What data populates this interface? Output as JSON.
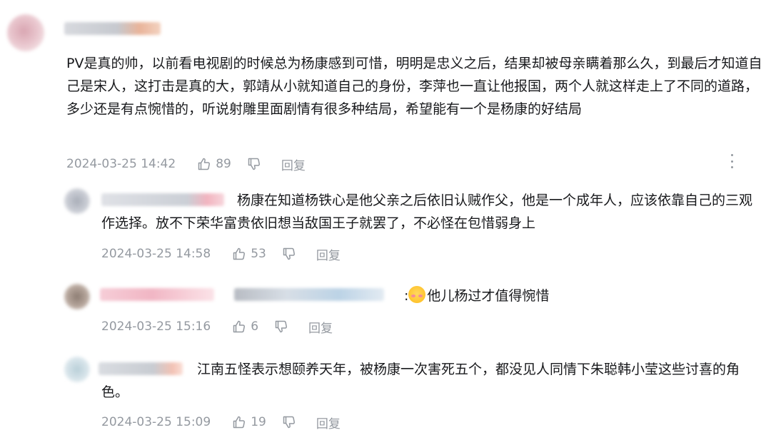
{
  "main_comment": {
    "text": "PV是真的帅，以前看电视剧的时候总为杨康感到可惜，明明是忠义之后，结果却被母亲瞒着那么久，到最后才知道自己是宋人，这打击是真的大，郭靖从小就知道自己的身份，李萍也一直让他报国，两个人就这样走上了不同的道路，多少还是有点惋惜的，听说射雕里面剧情有很多种结局，希望能有一个是杨康的好结局",
    "time": "2024-03-25 14:42",
    "likes": "89",
    "reply_label": "回复"
  },
  "replies": [
    {
      "text": "杨康在知道杨铁心是他父亲之后依旧认贼作父，他是一个成年人，应该依靠自己的三观作选择。放不下荣华富贵依旧想当敌国王子就罢了，不必怪在包惜弱身上",
      "time": "2024-03-25 14:58",
      "likes": "53",
      "reply_label": "回复"
    },
    {
      "prefix": ":",
      "text": "他儿杨过才值得惋惜",
      "time": "2024-03-25 15:16",
      "likes": "6",
      "reply_label": "回复"
    },
    {
      "text": "江南五怪表示想颐养天年，被杨康一次害死五个，都没见人同情下朱聪韩小莹这些讨喜的角色。",
      "time": "2024-03-25 15:09",
      "likes": "19",
      "reply_label": "回复"
    }
  ],
  "icons": {
    "like": "thumbs-up-icon",
    "dislike": "thumbs-down-icon",
    "more": "more-vertical-icon",
    "emoji": "shy-face-emoji-icon"
  },
  "colors": {
    "text": "#18191c",
    "meta": "#9499a0"
  }
}
